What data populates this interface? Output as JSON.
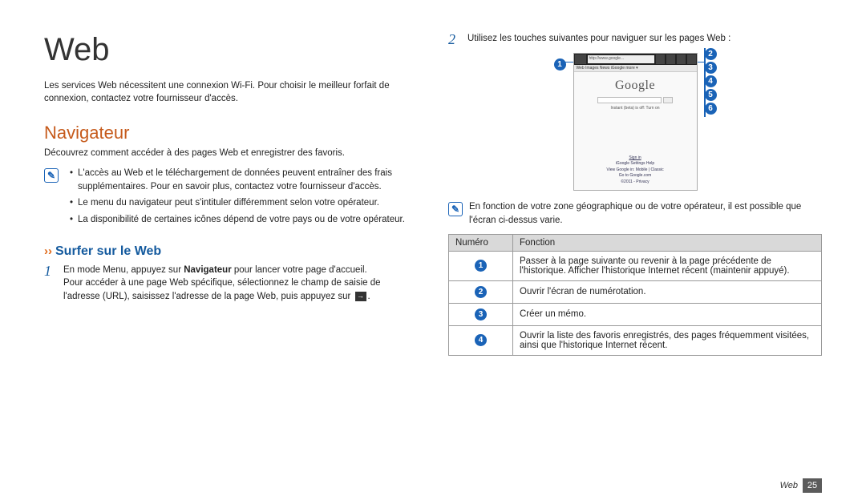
{
  "title": "Web",
  "intro": "Les services Web nécessitent une connexion Wi-Fi. Pour choisir le meilleur forfait de connexion, contactez votre fournisseur d'accès.",
  "navigator": {
    "heading": "Navigateur",
    "desc": "Découvrez comment accéder à des pages Web et enregistrer des favoris.",
    "notes": [
      "L'accès au Web et le téléchargement de données peuvent entraîner des frais supplémentaires. Pour en savoir plus, contactez votre fournisseur d'accès.",
      "Le menu du navigateur peut s'intituler différemment selon votre opérateur.",
      "La disponibilité de certaines icônes dépend de votre pays ou de votre opérateur."
    ]
  },
  "surf": {
    "heading": "Surfer sur le Web",
    "steps": [
      {
        "num": "1",
        "text_a": "En mode Menu, appuyez sur ",
        "bold": "Navigateur",
        "text_b": " pour lancer votre page d'accueil.",
        "text_c": "Pour accéder à une page Web spécifique, sélectionnez le champ de saisie de l'adresse (URL), saisissez l'adresse de la page Web, puis appuyez sur ",
        "text_d": "."
      },
      {
        "num": "2",
        "text": "Utilisez les touches suivantes pour naviguer sur les pages Web :"
      }
    ]
  },
  "phone": {
    "url": "http://www.google...",
    "tabs": "Web  Images  News  iGoogle  more ▾",
    "logo": "Google",
    "meta": "Instant (beta) is off: Turn on",
    "footer_signin": "Sign in",
    "footer_links": "iGoogle   Settings   Help",
    "footer_view": "View Google in: Mobile | Classic",
    "footer_goto": "Go to Google.com",
    "footer_copy": "©2011 - Privacy"
  },
  "callouts": [
    "1",
    "2",
    "3",
    "4",
    "5",
    "6"
  ],
  "right_note": "En fonction de votre zone géographique ou de votre opérateur, il est possible que l'écran ci-dessus varie.",
  "table": {
    "headers": [
      "Numéro",
      "Fonction"
    ],
    "rows": [
      {
        "n": "1",
        "fn": "Passer à la page suivante ou revenir à la page précédente de l'historique. Afficher l'historique Internet récent (maintenir appuyé)."
      },
      {
        "n": "2",
        "fn": "Ouvrir l'écran de numérotation."
      },
      {
        "n": "3",
        "fn": "Créer un mémo."
      },
      {
        "n": "4",
        "fn": "Ouvrir la liste des favoris enregistrés, des pages fréquemment visitées, ainsi que l'historique Internet récent."
      }
    ]
  },
  "footer": {
    "label": "Web",
    "page": "25"
  },
  "icons": {
    "note": "✎",
    "arrow": "→"
  }
}
